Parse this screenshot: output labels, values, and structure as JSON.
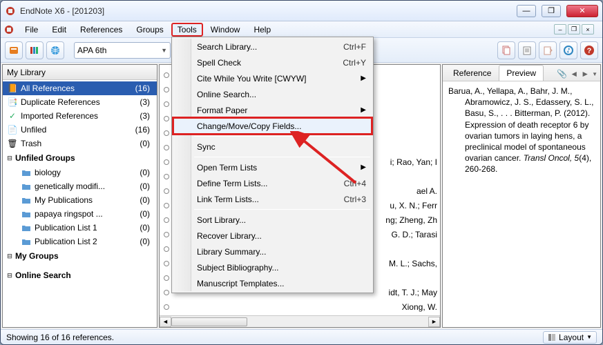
{
  "window": {
    "title": "EndNote X6 - [201203]"
  },
  "menubar": {
    "file": "File",
    "edit": "Edit",
    "references": "References",
    "groups": "Groups",
    "tools": "Tools",
    "window": "Window",
    "help": "Help"
  },
  "toolbar": {
    "style": "APA 6th"
  },
  "tools_menu": {
    "search": "Search Library...",
    "search_sc": "Ctrl+F",
    "spell": "Spell Check",
    "spell_sc": "Ctrl+Y",
    "cite": "Cite While You Write [CWYW]",
    "online": "Online Search...",
    "format": "Format Paper",
    "change": "Change/Move/Copy Fields...",
    "sync": "Sync",
    "openterm": "Open Term Lists",
    "defterm": "Define Term Lists...",
    "defterm_sc": "Ctrl+4",
    "linkterm": "Link Term Lists...",
    "linkterm_sc": "Ctrl+3",
    "sort": "Sort Library...",
    "recover": "Recover Library...",
    "summary": "Library Summary...",
    "subject": "Subject Bibliography...",
    "manuscript": "Manuscript Templates..."
  },
  "left": {
    "head": "My Library",
    "items": [
      {
        "icon": "📙",
        "label": "All References",
        "count": "(16)",
        "selected": true
      },
      {
        "icon": "📑",
        "label": "Duplicate References",
        "count": "(3)"
      },
      {
        "icon": "✓",
        "label": "Imported References",
        "count": "(3)",
        "green": true
      },
      {
        "icon": "📄",
        "label": "Unfiled",
        "count": "(16)"
      },
      {
        "icon": "🗑",
        "label": "Trash",
        "count": "(0)"
      }
    ],
    "group_unfiled": "Unfiled Groups",
    "unfiled": [
      {
        "label": "biology",
        "count": "(0)"
      },
      {
        "label": "genetically modifi...",
        "count": "(0)"
      },
      {
        "label": "My Publications",
        "count": "(0)"
      },
      {
        "label": "papaya ringspot ...",
        "count": "(0)"
      },
      {
        "label": "Publication List 1",
        "count": "(0)"
      },
      {
        "label": "Publication List 2",
        "count": "(0)"
      }
    ],
    "group_my": "My Groups",
    "group_online": "Online Search"
  },
  "mid": {
    "rows": [
      "",
      "",
      "",
      "",
      "",
      "",
      "i; Rao, Yan; I",
      "",
      "ael A.",
      "u, X. N.; Ferr",
      "ng; Zheng, Zh",
      "G. D.; Tarasi",
      "",
      "M. L.; Sachs,",
      "",
      "idt, T. J.; May",
      "Xiong, W.",
      ""
    ]
  },
  "preview": {
    "tab_ref": "Reference",
    "tab_prev": "Preview",
    "text": "Barua, A., Yellapa, A., Bahr, J. M., Abramowicz, J. S., Edassery, S. L., Basu, S., . . . Bitterman, P. (2012). Expression of death receptor 6 by ovarian tumors in laying hens, a preclinical model of spontaneous ovarian cancer. ",
    "italic": "Transl Oncol, 5",
    "rest": "(4), 260-268."
  },
  "status": {
    "text": "Showing 16 of 16 references.",
    "layout": "Layout"
  }
}
